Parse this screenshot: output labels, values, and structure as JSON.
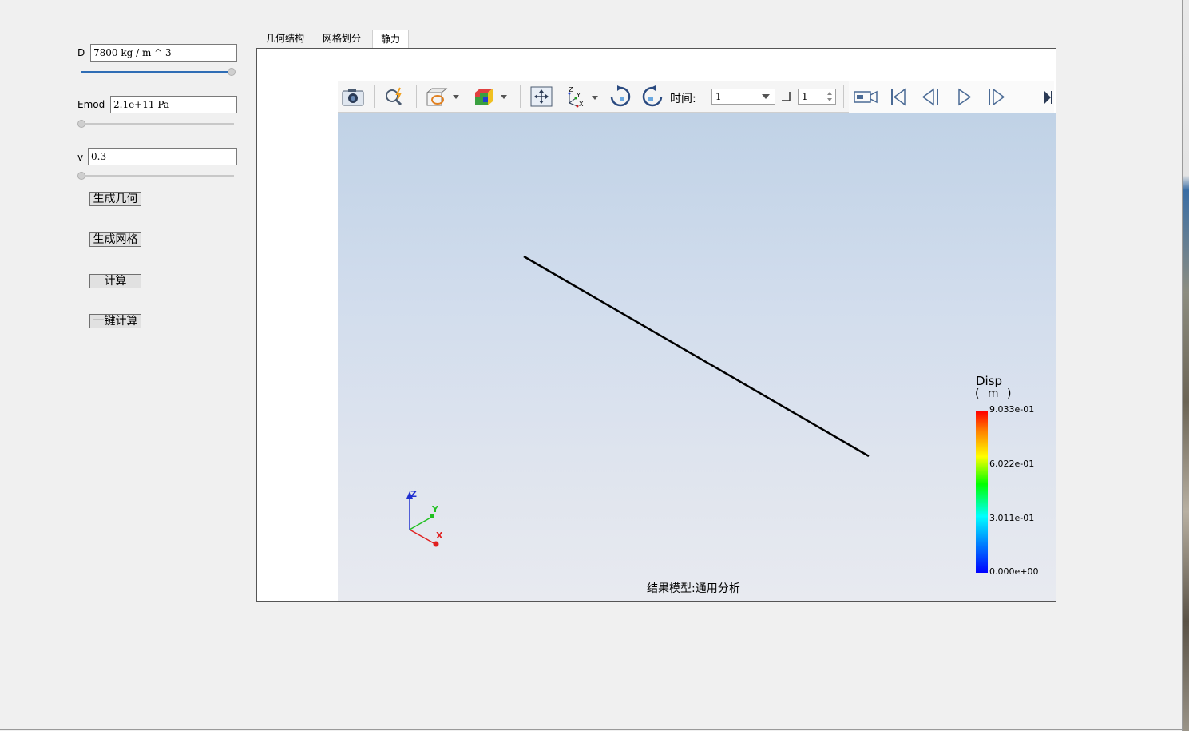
{
  "left_panel": {
    "density": {
      "label": "D",
      "value": "7800 kg / m ^ 3",
      "slider_fraction": 1.0
    },
    "emod": {
      "label": "Emod",
      "value": "2.1e+11 Pa",
      "slider_fraction": 0.0
    },
    "poisson": {
      "label": "v",
      "value": "0.3",
      "slider_fraction": 0.0
    },
    "buttons": {
      "generate_geometry": "生成几何",
      "generate_mesh": "生成网格",
      "compute": "计算",
      "one_click_compute": "一键计算"
    }
  },
  "tabs": [
    {
      "label": "几何结构",
      "active": false
    },
    {
      "label": "网格划分",
      "active": false
    },
    {
      "label": "静力",
      "active": true
    }
  ],
  "toolbar": {
    "time_label": "时间:",
    "time_value": "1",
    "step_value": "1",
    "icons": [
      "camera-icon",
      "zoom-icon",
      "section-view-icon",
      "color-cube-icon",
      "fit-view-icon",
      "axes-orientation-icon",
      "rotate-cw-icon",
      "rotate-ccw-icon",
      "record-icon",
      "first-frame-icon",
      "prev-frame-icon",
      "play-icon",
      "next-frame-icon",
      "last-frame-icon"
    ]
  },
  "viewport": {
    "footer_text": "结果模型:通用分析",
    "axes": {
      "z": "Z",
      "y": "Y",
      "x": "X"
    },
    "legend": {
      "title": "Disp",
      "unit": "( m )",
      "ticks": [
        "9.033e-01",
        "6.022e-01",
        "3.011e-01",
        "0.000e+00"
      ]
    }
  },
  "colors": {
    "slider_accent": "#2f6db5",
    "beam": "#000000",
    "axis_x": "#e02020",
    "axis_y": "#20c020",
    "axis_z": "#2030d0"
  }
}
